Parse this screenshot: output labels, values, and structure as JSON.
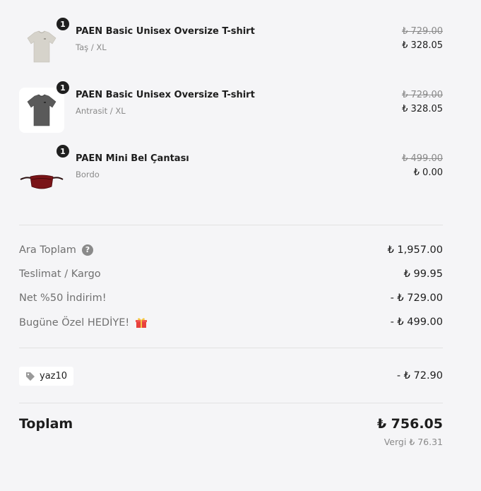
{
  "items": [
    {
      "quantity": "1",
      "name": "PAEN Basic Unisex Oversize T-shirt",
      "variant": "Taş / XL",
      "original_price": "₺ 729.00",
      "price": "₺ 328.05",
      "image": "tshirt-stone-icon"
    },
    {
      "quantity": "1",
      "name": "PAEN Basic Unisex Oversize T-shirt",
      "variant": "Antrasit / XL",
      "original_price": "₺ 729.00",
      "price": "₺ 328.05",
      "image": "tshirt-anthracite-icon"
    },
    {
      "quantity": "1",
      "name": "PAEN Mini Bel Çantası",
      "variant": "Bordo",
      "original_price": "₺ 499.00",
      "price": "₺ 0.00",
      "image": "belt-bag-icon"
    }
  ],
  "summary": {
    "subtotal_label": "Ara Toplam",
    "subtotal_value": "₺ 1,957.00",
    "shipping_label": "Teslimat / Kargo",
    "shipping_value": "₺ 99.95",
    "discount_label": "Net %50 İndirim!",
    "discount_value": "- ₺ 729.00",
    "gift_label": "Bugüne Özel HEDİYE!",
    "gift_value": "- ₺ 499.00"
  },
  "help_glyph": "?",
  "coupon": {
    "code": "yaz10",
    "value": "- ₺ 72.90"
  },
  "total": {
    "label": "Toplam",
    "value": "₺ 756.05",
    "tax": "Vergi ₺ 76.31"
  },
  "colors": {
    "background": "#f5f5f7",
    "text": "#1d1d1d",
    "muted": "#707070",
    "divider": "#e2e2e2",
    "badge": "#1f1f1f"
  }
}
